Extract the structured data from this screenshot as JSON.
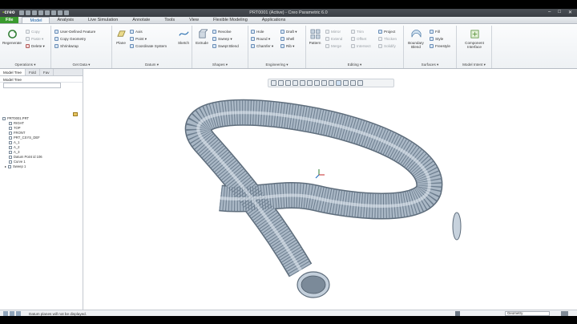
{
  "app": {
    "logo": "creo",
    "window_title": "PRT0001 (Active) - Creo Parametric 6.0",
    "window_controls": [
      "–",
      "□",
      "✕"
    ]
  },
  "tabs": [
    "File",
    "Model",
    "Analysis",
    "Live Simulation",
    "Annotate",
    "Tools",
    "View",
    "Flexible Modeling",
    "Applications"
  ],
  "active_tab": "Model",
  "ribbon": {
    "operations": {
      "label": "Operations ▾",
      "regenerate": "Regenerate",
      "items": [
        "Copy",
        "Paste ▾",
        "Delete ▾"
      ]
    },
    "get_data": {
      "label": "Get Data ▾",
      "items": [
        "User-Defined Feature",
        "Copy Geometry",
        "Shrinkwrap"
      ]
    },
    "datum": {
      "label": "Datum ▾",
      "plane": "Plane",
      "items": [
        "Axis",
        "Point ▾",
        "Coordinate System"
      ],
      "sketch": "Sketch"
    },
    "shapes": {
      "label": "Shapes ▾",
      "extrude": "Extrude",
      "items": [
        "Revolve",
        "Sweep ▾",
        "Swept Blend"
      ]
    },
    "engineering": {
      "label": "Engineering ▾",
      "items": [
        "Hole",
        "Round ▾",
        "Chamfer ▾",
        "Draft ▾",
        "Shell",
        "Rib ▾"
      ]
    },
    "editing": {
      "label": "Editing ▾",
      "pattern": "Pattern",
      "items": [
        "Mirror",
        "Extend",
        "Merge",
        "Trim",
        "Offset",
        "Intersect",
        "Project",
        "Thicken",
        "Solidify"
      ]
    },
    "surfaces": {
      "label": "Surfaces ▾",
      "boundary": "Boundary Blend",
      "items": [
        "Fill",
        "Style",
        "Freestyle"
      ]
    },
    "model_intent": {
      "label": "Model Intent ▾",
      "component": "Component Interface"
    }
  },
  "panel": {
    "tabs": [
      "Model Tree",
      "Fold",
      "Fav"
    ],
    "tree_items": [
      "PRT0001.PRT",
      "RIGHT",
      "TOP",
      "FRONT",
      "PRT_CSYS_DEF",
      "A_1",
      "A_2",
      "A_3",
      "Datum Point id 106",
      "Curve 1",
      "Sweep 1"
    ]
  },
  "status": {
    "message": "Datum planes will not be displayed.",
    "selection_filter": "Geometry"
  },
  "colors": {
    "file_tab": "#3a9a2e",
    "hose": "#a9b7c6",
    "accent": "#1b62a8"
  }
}
